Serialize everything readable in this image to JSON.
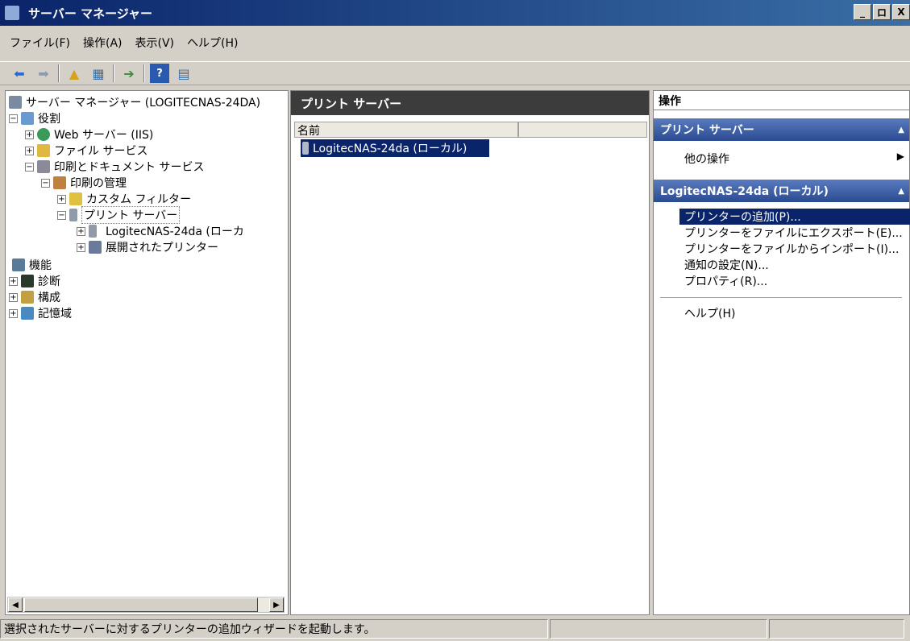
{
  "window": {
    "title": "サーバー マネージャー",
    "buttons": [
      "_",
      "ロ",
      "X"
    ]
  },
  "menu": [
    "ファイル(F)",
    "操作(A)",
    "表示(V)",
    "ヘルプ(H)"
  ],
  "tree": {
    "root": "サーバー マネージャー (LOGITECNAS-24DA)",
    "roles": "役割",
    "web": "Web サーバー (IIS)",
    "file": "ファイル サービス",
    "print": "印刷とドキュメント サービス",
    "print_mgmt": "印刷の管理",
    "custom_filter": "カスタム フィルター",
    "print_servers": "プリント サーバー",
    "server_node": "LogitecNAS-24da (ローカ",
    "deployed": "展開されたプリンター",
    "features": "機能",
    "diagnostics": "診断",
    "config": "構成",
    "storage": "記憶域"
  },
  "center": {
    "header": "プリント サーバー",
    "column": "名前",
    "row": "LogitecNAS-24da (ローカル)"
  },
  "actions": {
    "header": "操作",
    "section1": "プリント サーバー",
    "other": "他の操作",
    "section2": "LogitecNAS-24da (ローカル)",
    "items": [
      "プリンターの追加(P)...",
      "プリンターをファイルにエクスポート(E)...",
      "プリンターをファイルからインポート(I)...",
      "通知の設定(N)...",
      "プロパティ(R)..."
    ],
    "help": "ヘルプ(H)"
  },
  "status": {
    "text": "選択されたサーバーに対するプリンターの追加ウィザードを起動します。"
  }
}
